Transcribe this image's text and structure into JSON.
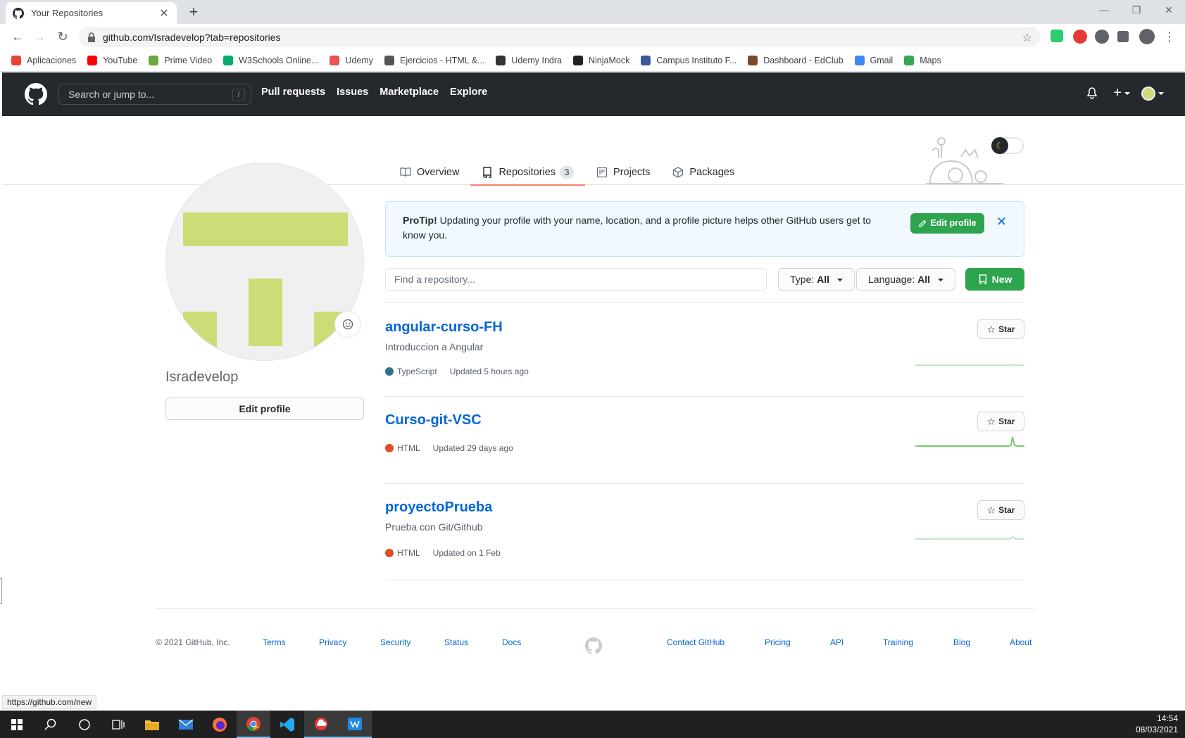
{
  "browser": {
    "tab_title": "Your Repositories",
    "new_tab_symbol": "+",
    "url": "github.com/Isradevelop?tab=repositories",
    "bookmarks": [
      {
        "label": "Aplicaciones",
        "color": "#ea4335"
      },
      {
        "label": "YouTube",
        "color": "#ff0000"
      },
      {
        "label": "Prime Video",
        "color": "#6aa839"
      },
      {
        "label": "W3Schools Online...",
        "color": "#04aa6d"
      },
      {
        "label": "Udemy",
        "color": "#ec5252"
      },
      {
        "label": "Ejercicios - HTML &...",
        "color": "#555555"
      },
      {
        "label": "Udemy Indra",
        "color": "#333333"
      },
      {
        "label": "NinjaMock",
        "color": "#222222"
      },
      {
        "label": "Campus Instituto F...",
        "color": "#3b5998"
      },
      {
        "label": "Dashboard - EdClub",
        "color": "#7a4a2a"
      },
      {
        "label": "Gmail",
        "color": "#4285f4"
      },
      {
        "label": "Maps",
        "color": "#34a853"
      }
    ]
  },
  "header": {
    "search_placeholder": "Search or jump to...",
    "search_shortcut": "/",
    "nav": [
      "Pull requests",
      "Issues",
      "Marketplace",
      "Explore"
    ]
  },
  "profile_tabs": [
    {
      "label": "Overview",
      "icon": "book-icon"
    },
    {
      "label": "Repositories",
      "icon": "repo-icon",
      "count": "3",
      "selected": true
    },
    {
      "label": "Projects",
      "icon": "project-icon"
    },
    {
      "label": "Packages",
      "icon": "package-icon"
    }
  ],
  "profile": {
    "username": "Isradevelop",
    "edit_button": "Edit profile"
  },
  "protip": {
    "title": "ProTip!",
    "text": " Updating your profile with your name, location, and a profile picture helps other GitHub users get to know you.",
    "button": "Edit profile"
  },
  "filters": {
    "find_placeholder": "Find a repository...",
    "type_label": "Type:",
    "type_value": "All",
    "language_label": "Language:",
    "language_value": "All",
    "new_button": "New"
  },
  "repos": [
    {
      "name": "angular-curso-FH",
      "description": "Introduccion a Angular",
      "language": "TypeScript",
      "lang_color": "#2b7489",
      "updated": "Updated 5 hours ago",
      "star": "Star"
    },
    {
      "name": "Curso-git-VSC",
      "description": "",
      "language": "HTML",
      "lang_color": "#e34c26",
      "updated": "Updated 29 days ago",
      "star": "Star"
    },
    {
      "name": "proyectoPrueba",
      "description": "Prueba con Git/Github",
      "language": "HTML",
      "lang_color": "#e34c26",
      "updated": "Updated on 1 Feb",
      "star": "Star"
    }
  ],
  "footer": {
    "copyright": "© 2021 GitHub, Inc.",
    "left_links": [
      "Terms",
      "Privacy",
      "Security",
      "Status",
      "Docs"
    ],
    "right_links": [
      "Contact GitHub",
      "Pricing",
      "API",
      "Training",
      "Blog",
      "About"
    ]
  },
  "status_url": "https://github.com/new",
  "taskbar": {
    "time": "14:54",
    "date": "08/03/2021"
  }
}
